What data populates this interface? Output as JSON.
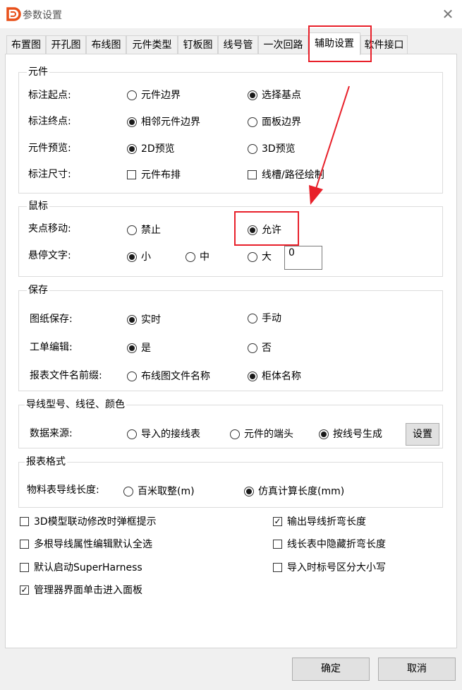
{
  "window": {
    "title": "参数设置",
    "close_symbol": "✕"
  },
  "tabs": [
    "布置图",
    "开孔图",
    "布线图",
    "元件类型",
    "钉板图",
    "线号管",
    "一次回路",
    "辅助设置",
    "软件接口"
  ],
  "active_tab": "辅助设置",
  "group_component": {
    "title": "元件",
    "rows": [
      {
        "label": "标注起点:",
        "opt1": "元件边界",
        "opt2": "选择基点"
      },
      {
        "label": "标注终点:",
        "opt1": "相邻元件边界",
        "opt2": "面板边界"
      },
      {
        "label": "元件预览:",
        "opt1": "2D预览",
        "opt2": "3D预览"
      },
      {
        "label": "标注尺寸:",
        "opt1": "元件布排",
        "opt2": "线槽/路径绘制"
      }
    ]
  },
  "group_mouse": {
    "title": "鼠标",
    "row1": {
      "label": "夹点移动:",
      "opt1": "禁止",
      "opt2": "允许"
    },
    "row2": {
      "label": "悬停文字:",
      "opt1": "小",
      "opt2": "中",
      "opt3": "大",
      "value": "0"
    }
  },
  "group_save": {
    "title": "保存",
    "rows": [
      {
        "label": "图纸保存:",
        "opt1": "实时",
        "opt2": "手动"
      },
      {
        "label": "工单编辑:",
        "opt1": "是",
        "opt2": "否"
      },
      {
        "label": "报表文件名前缀:",
        "opt1": "布线图文件名称",
        "opt2": "柜体名称"
      }
    ]
  },
  "group_wire": {
    "title": "导线型号、线径、颜色",
    "label": "数据来源:",
    "opt1": "导入的接线表",
    "opt2": "元件的端头",
    "opt3": "按线号生成",
    "button": "设置"
  },
  "group_report": {
    "title": "报表格式",
    "label": "物料表导线长度:",
    "opt1": "百米取整(m)",
    "opt2": "仿真计算长度(mm)"
  },
  "checkboxes": {
    "c1": "3D模型联动修改时弹框提示",
    "c2": "输出导线折弯长度",
    "c3": "多根导线属性编辑默认全选",
    "c4": "线长表中隐藏折弯长度",
    "c5": "默认启动SuperHarness",
    "c6": "导入时标号区分大小写",
    "c7": "管理器界面单击进入面板"
  },
  "check_mark": "✓",
  "buttons": {
    "ok": "确定",
    "cancel": "取消"
  },
  "colors": {
    "highlight": "#e8202a",
    "logo": "#e8501a"
  }
}
